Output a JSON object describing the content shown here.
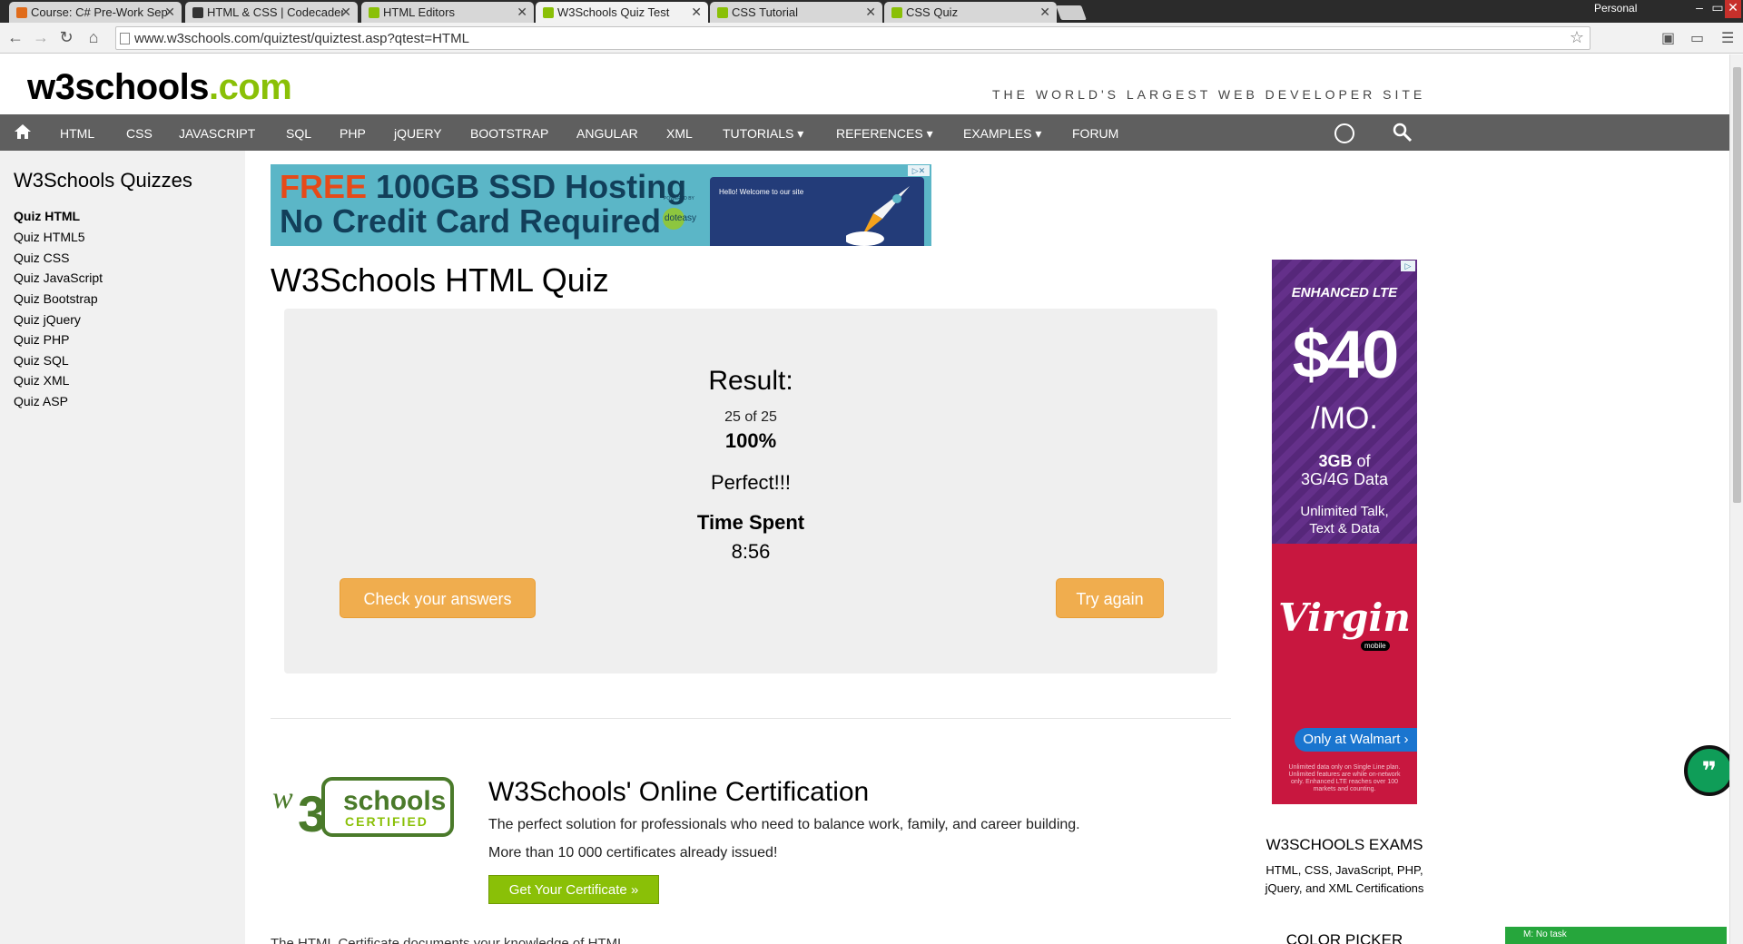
{
  "browser": {
    "tabs": [
      {
        "title": "Course: C# Pre-Work Sept",
        "active": false,
        "fav_color": "#e06b1a"
      },
      {
        "title": "HTML & CSS | Codecaden",
        "active": false,
        "fav_color": "#333333"
      },
      {
        "title": "HTML Editors",
        "active": false,
        "fav_color": "#8ac007"
      },
      {
        "title": "W3Schools Quiz Test",
        "active": true,
        "fav_color": "#8ac007"
      },
      {
        "title": "CSS Tutorial",
        "active": false,
        "fav_color": "#8ac007"
      },
      {
        "title": "CSS Quiz",
        "active": false,
        "fav_color": "#8ac007"
      }
    ],
    "profile": "Personal",
    "url": "www.w3schools.com/quiztest/quiztest.asp?qtest=HTML"
  },
  "header": {
    "logo_main": "w3schools",
    "logo_suffix": ".com",
    "tagline": "THE WORLD'S LARGEST WEB DEVELOPER SITE"
  },
  "topnav": {
    "items": [
      "HTML",
      "CSS",
      "JAVASCRIPT",
      "SQL",
      "PHP",
      "jQUERY",
      "BOOTSTRAP",
      "ANGULAR",
      "XML",
      "TUTORIALS ▾",
      "REFERENCES ▾",
      "EXAMPLES ▾",
      "FORUM"
    ]
  },
  "sidebar": {
    "title": "W3Schools Quizzes",
    "items": [
      "Quiz HTML",
      "Quiz HTML5",
      "Quiz CSS",
      "Quiz JavaScript",
      "Quiz Bootstrap",
      "Quiz jQuery",
      "Quiz PHP",
      "Quiz SQL",
      "Quiz XML",
      "Quiz ASP"
    ]
  },
  "ad_top": {
    "free": "FREE",
    "line1_rest": " 100GB SSD Hosting",
    "line2": "No Credit Card Required",
    "powered": "POWERED BY",
    "brand": "doteasy",
    "screen_text": "Hello! Welcome to our site"
  },
  "main": {
    "title": "W3Schools HTML Quiz",
    "result": {
      "title": "Result:",
      "score": "25 of 25",
      "percent": "100%",
      "message": "Perfect!!!",
      "time_label": "Time Spent",
      "time": "8:56",
      "check_label": "Check your answers",
      "retry_label": "Try again"
    },
    "cert": {
      "logo_top": "schools",
      "logo_bottom": "CERTIFIED",
      "title": "W3Schools' Online Certification",
      "desc1": "The perfect solution for professionals who need to balance work, family, and career building.",
      "desc2": "More than 10 000 certificates already issued!",
      "button": "Get Your Certificate »",
      "cutoff": "The HTML Certificate documents your knowledge of HTML."
    }
  },
  "ad_side": {
    "enhanced": "ENHANCED LTE",
    "price": "$40",
    "per": "/MO.",
    "data_bold": "3GB",
    "data_rest": " of",
    "data_line2": "3G/4G Data",
    "unlimited": "Unlimited Talk,",
    "unlimited2": "Text & Data",
    "virgin": "Virgin",
    "mobile": "mobile",
    "walmart": "Only at Walmart ›",
    "fine": "Unlimited data only on Single Line plan. Unlimited features are while on-network only. Enhanced LTE reaches over 100 markets and counting."
  },
  "right": {
    "exams_title": "W3SCHOOLS EXAMS",
    "exams_desc1": "HTML, CSS, JavaScript, PHP,",
    "exams_desc2": "jQuery, and XML Certifications",
    "picker_title": "COLOR PICKER"
  },
  "status": {
    "notask": "M:  No task"
  },
  "colors": {
    "brand_green": "#8ac007",
    "nav_gray": "#5f5f5f",
    "button_orange": "#f0ad4e"
  }
}
